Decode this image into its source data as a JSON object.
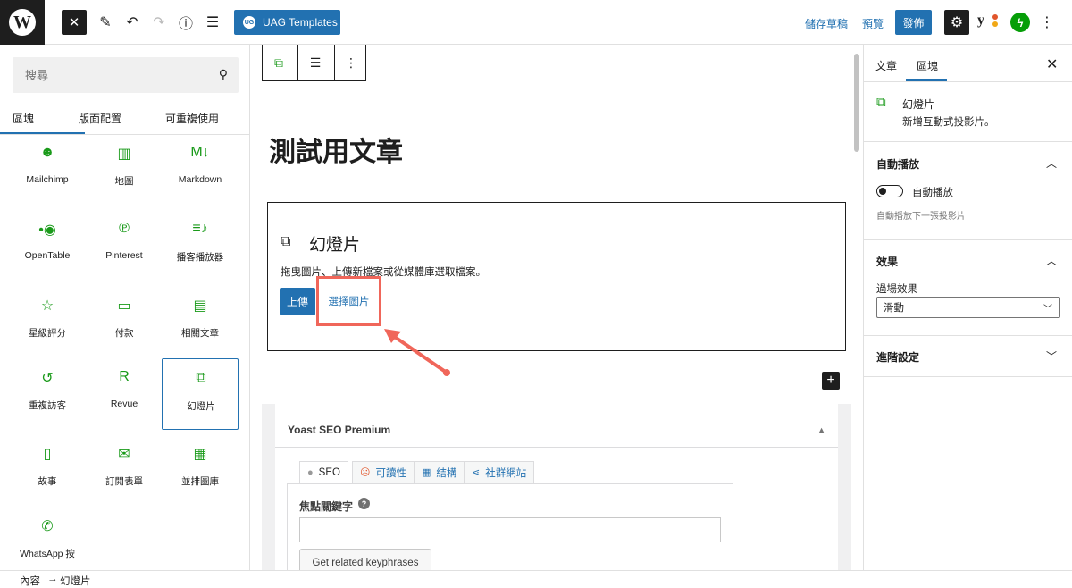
{
  "topbar": {
    "uag_label": "UAG Templates",
    "uag_badge": "UG",
    "save_draft": "儲存草稿",
    "preview": "預覽",
    "publish": "發佈",
    "yoast_letter": "y"
  },
  "inserter": {
    "search_placeholder": "搜尋",
    "tabs": [
      "區塊",
      "版面配置",
      "可重複使用"
    ],
    "blocks": [
      {
        "label": "Mailchimp",
        "icon": "mailchimp-icon",
        "glyph": "☻"
      },
      {
        "label": "地圖",
        "icon": "map-icon",
        "glyph": "▥"
      },
      {
        "label": "Markdown",
        "icon": "markdown-icon",
        "glyph": "M↓"
      },
      {
        "label": "OpenTable",
        "icon": "opentable-icon",
        "glyph": "•◉"
      },
      {
        "label": "Pinterest",
        "icon": "pinterest-icon",
        "glyph": "℗"
      },
      {
        "label": "播客播放器",
        "icon": "podcast-icon",
        "glyph": "≡♪"
      },
      {
        "label": "星級評分",
        "icon": "star-icon",
        "glyph": "☆"
      },
      {
        "label": "付款",
        "icon": "payment-icon",
        "glyph": "▭"
      },
      {
        "label": "相關文章",
        "icon": "related-posts-icon",
        "glyph": "▤"
      },
      {
        "label": "重複訪客",
        "icon": "repeat-visitor-icon",
        "glyph": "↺"
      },
      {
        "label": "Revue",
        "icon": "revue-icon",
        "glyph": "R"
      },
      {
        "label": "幻燈片",
        "icon": "slideshow-icon",
        "glyph": "⧉"
      },
      {
        "label": "故事",
        "icon": "story-icon",
        "glyph": "▯"
      },
      {
        "label": "訂閱表單",
        "icon": "subscribe-icon",
        "glyph": "✉"
      },
      {
        "label": "並排圖庫",
        "icon": "tiled-gallery-icon",
        "glyph": "▦"
      },
      {
        "label": "WhatsApp 按",
        "icon": "whatsapp-icon",
        "glyph": "✆"
      }
    ]
  },
  "canvas": {
    "post_title": "測試用文章",
    "slider": {
      "title": "幻燈片",
      "instructions": "拖曳圖片、上傳新檔案或從媒體庫選取檔案。",
      "upload": "上傳",
      "choose": "選擇圖片"
    },
    "yoast": {
      "title": "Yoast SEO Premium",
      "tabs": [
        {
          "label": "SEO",
          "icon": "seo-dot-icon"
        },
        {
          "label": "可讀性",
          "icon": "readability-face-icon"
        },
        {
          "label": "結構",
          "icon": "schema-grid-icon"
        },
        {
          "label": "社群網站",
          "icon": "social-share-icon"
        }
      ],
      "keyphrase_label": "焦點關鍵字",
      "keyphrase_value": "",
      "related_button": "Get related keyphrases"
    }
  },
  "sidebar": {
    "tabs": [
      "文章",
      "區塊"
    ],
    "block_title": "幻燈片",
    "block_desc": "新增互動式投影片。",
    "autoplay_section": "自動播放",
    "autoplay_toggle_label": "自動播放",
    "autoplay_help": "自動播放下一張投影片",
    "effects_section": "效果",
    "transition_label": "過場效果",
    "transition_value": "滑動",
    "advanced_section": "進階設定"
  },
  "footer": {
    "crumbs": [
      "內容",
      "幻燈片"
    ]
  },
  "colors": {
    "accent": "#2271b1",
    "highlight": "#f0665a",
    "block_icon": "#1a9a1a"
  }
}
